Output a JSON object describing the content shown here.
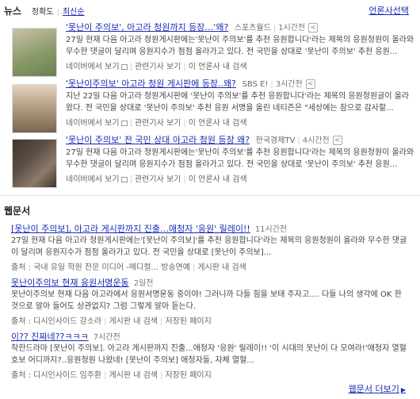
{
  "news": {
    "title": "뉴스",
    "sort": [
      "정확도",
      "최신순"
    ],
    "press_link": "언론사선택",
    "share_icon": "share-icon",
    "items": [
      {
        "headline": "'못난이 주의보', 아고라 청원까지 등장…'왜?",
        "press": "스포츠월드",
        "time": "1시간전",
        "snippet_plain": "27일 현재 다음 아고라 청원게시판에는'못난이 주의보'를 추천 응원합니다'라는 제목의 응원청원이 올라와 무수한 댓글이 달리며 응원지수가 점점 올라가고 있다. 전 국민을 상대로 '못난이 주의보' 추천 응원...",
        "meta": [
          "네이버에서 보기",
          "관련기사 보기",
          "이 언론사 내 검색"
        ],
        "thumb_color": "#8a9a6a"
      },
      {
        "headline": "'못난이주의보' 아고라 청원 게시판에 등장..왜?",
        "press": "SBS E!",
        "time": "3시간전",
        "snippet_plain": "지난 22일 다음 아고라 청원게시판에 '못난이 주의보'를 추천 응원합니다'라는 제목의 응원청원글이 올라왔다. 전 국민을 상대로 '못난이 주의보' 추천 응원 서명을 올린 네티즌은 \"세상에는 참으로 감사할...",
        "meta": [
          "네이버에서 보기",
          "관련기사 보기",
          "이 언론사 내 검색"
        ],
        "thumb_color": "#b09a80"
      },
      {
        "headline": "'못난이 주의보' 전 국민 상대 아고라 청원 등장 왜?",
        "press": "한국경제TV",
        "time": "4시간전",
        "snippet_plain": "27일 현재 다음 아고라 청원게시판에는'못난이 주의보'를 추천 응원합니다'라는 제목의 응원청원이 올라와 무수한 댓글이 달리며 응원지수가 점점 올라가고 있다. 전 국민을 상대로 '못난이 주의보' 추천 응원...",
        "meta": [
          "네이버에서 보기",
          "관련기사 보기",
          "이 언론사 내 검색"
        ],
        "thumb_color": "#5c5046"
      }
    ]
  },
  "web": {
    "title": "웹문서",
    "more_link": "웹문서 더보기",
    "items": [
      {
        "title": "[못난이 주의보], 아고라 게시판까지 진출…애청자 '응원' 릴레이!!",
        "time": "11시간전",
        "snippet": "27일 현재 다음 아고라 청원게시판에는'[못난이 주의보]'를 추천 응원합니다'라는 제목의 응원청원이 올라와 무수한 댓글이 달리며 응원지수가 점점 올라가고 있다. 전 국민을 상대로 [못난이 주의보]...",
        "meta": [
          "출처 : 국내 유일 학원 전문 미디어 -메디컬... 방송연예",
          "게시판 내 검색"
        ]
      },
      {
        "title": "못난이주의보 현재 응원서명운동",
        "time": "2일전",
        "snippet": "못난이주의보 현재 다음 아고라에서 응원서명운동 중이야! 그러니까 다들 힘을 보태 주자고.... 다들 나의 생각에 OK 한 것으로 알아 들어도 상관없지? 그럼 그렇게 알아 듣는다.",
        "meta": [
          "출처 : 디시인사이드 강소라",
          "게시판 내 검색",
          "저장된 페이지"
        ]
      },
      {
        "title": "이?? 진짜네??ㅋㅋㅋ",
        "time": "7시간전",
        "snippet": "착한드라마 [못난이 주의보]. 아고라 게시판까지 진출...애청자 '응원' 릴레이!! '이 시대의 못난이 다 모여라!'애청자 열혈 호보 어디까지?..응원청원 나왔네! [못난이 주의보] 애청자들, 자체 열혈...",
        "meta": [
          "출처 : 디시인사이드 임주환",
          "게시판 내 검색",
          "저장된 페이지"
        ]
      }
    ]
  }
}
